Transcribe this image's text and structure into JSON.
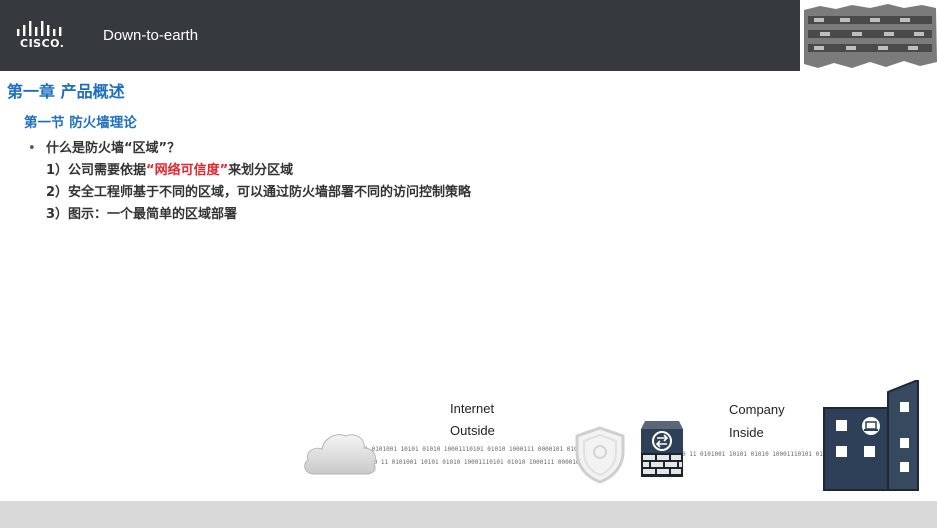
{
  "header": {
    "logo_text": "CISCO.",
    "title": "Down-to-earth"
  },
  "chapter_title": "第一章 产品概述",
  "section_title": "第一节 防火墙理论",
  "bullet": {
    "text": "什么是防火墙“区域”？",
    "items": [
      {
        "prefix": "1）公司需要依据",
        "highlight": "“网络可信度”",
        "suffix": "来划分区域"
      },
      {
        "prefix": "2）安全工程师基于不同的区域，可以通过防火墙部署不同的访问控制策略",
        "highlight": "",
        "suffix": ""
      },
      {
        "prefix": "3）图示：一个最简单的区域部署",
        "highlight": "",
        "suffix": ""
      }
    ]
  },
  "diagram": {
    "left_label_1": "Internet",
    "left_label_2": "Outside",
    "right_label_1": "Company",
    "right_label_2": "Inside",
    "binary_left_1": "10 11 0101001 10101 01010 10001110101 01010 1000111 0000101 0101",
    "binary_left_2": "10 11 0101001 10101 01010 10001110101 01010 1000111 0000101 0101 01010",
    "binary_right": "0 11 0101001 10101 01010 10001110101 01010"
  },
  "colors": {
    "header_bg": "#36393d",
    "heading_blue": "#1f6fbf",
    "highlight_red": "#e3262b",
    "building": "#2e4057",
    "footer": "#d9d9d9"
  },
  "icons": {
    "logo": "cisco-logo-icon",
    "cloud": "cloud-icon",
    "shield": "shield-icon",
    "firewall": "firewall-icon",
    "building": "building-icon"
  }
}
